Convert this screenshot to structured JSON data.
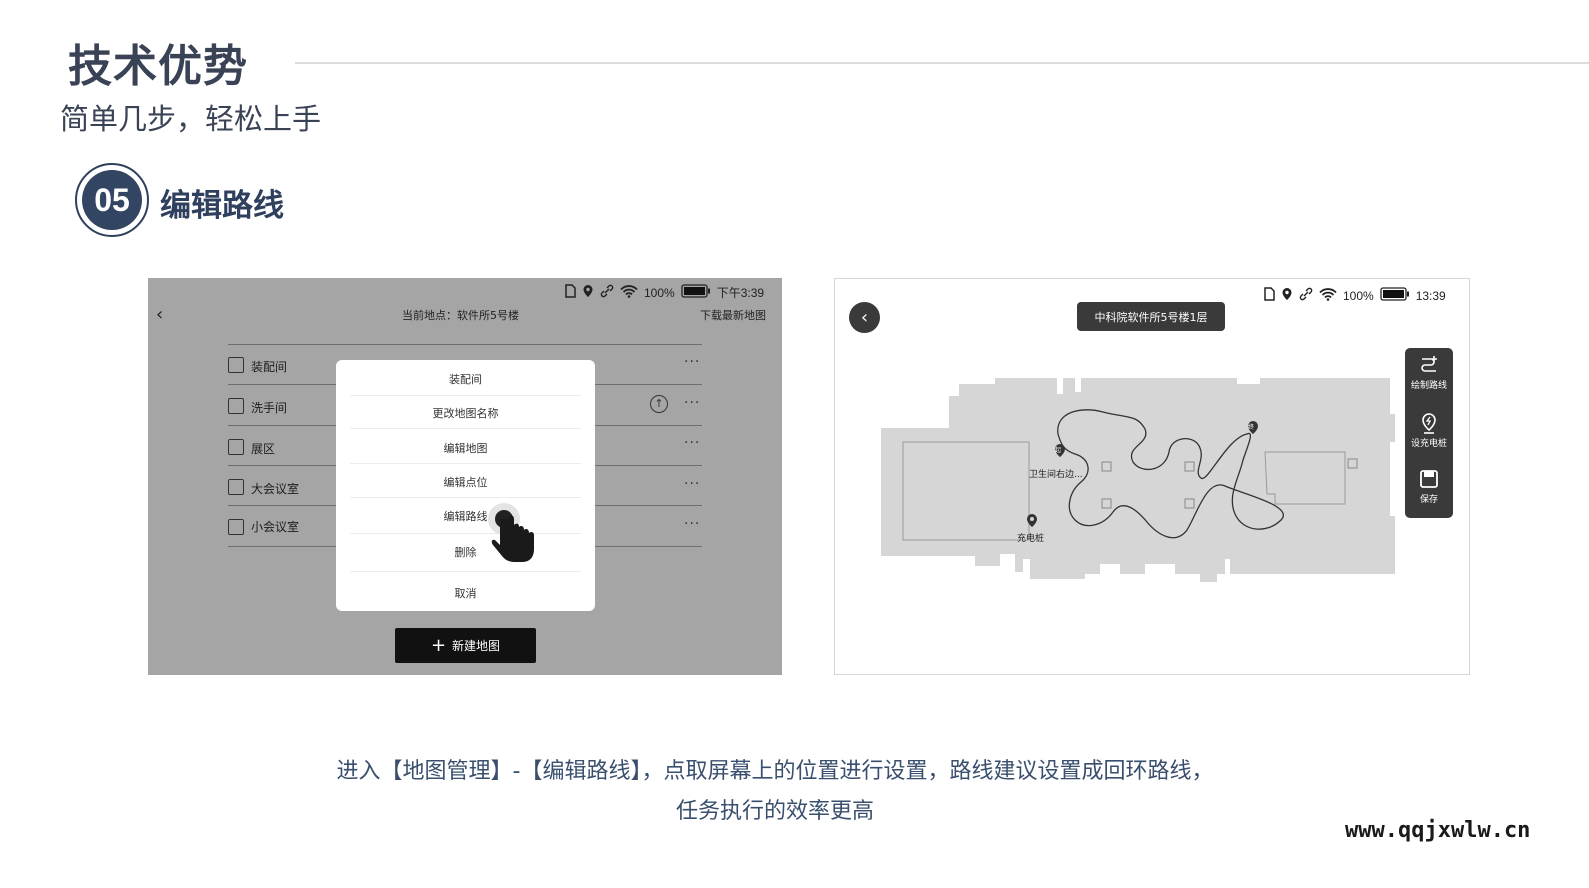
{
  "header": {
    "title": "技术优势",
    "subtitle": "简单几步，轻松上手"
  },
  "step": {
    "number": "05",
    "title": "编辑路线"
  },
  "left_screen": {
    "status": {
      "battery": "100%",
      "time": "下午3:39"
    },
    "location_label": "当前地点：软件所5号楼",
    "download_label": "下载最新地图",
    "rows": [
      "装配间",
      "洗手间",
      "展区",
      "大会议室",
      "小会议室"
    ],
    "menu": {
      "header": "装配间",
      "items": [
        "更改地图名称",
        "编辑地图",
        "编辑点位",
        "编辑路线",
        "删除"
      ],
      "cancel": "取消"
    },
    "new_map_button": "新建地图"
  },
  "right_screen": {
    "status": {
      "battery": "100%",
      "time": "13:39"
    },
    "map_title": "中科院软件所5号楼1层",
    "tools": [
      "绘制路线",
      "设充电桩",
      "保存"
    ],
    "markers": {
      "start": "起",
      "end": "终",
      "restroom": "卫生间右边...",
      "charger": "充电桩"
    }
  },
  "caption": {
    "line1": "进入【地图管理】-【编辑路线】，点取屏幕上的位置进行设置，路线建议设置成回环路线，",
    "line2": "任务执行的效率更高"
  },
  "watermark": "www.qqjxwlw.cn",
  "colors": {
    "title": "#3a4356",
    "badge": "#324563",
    "caption": "#3a4f6e",
    "overlay": "#a5a5a5",
    "dark": "#3a3a3a"
  }
}
